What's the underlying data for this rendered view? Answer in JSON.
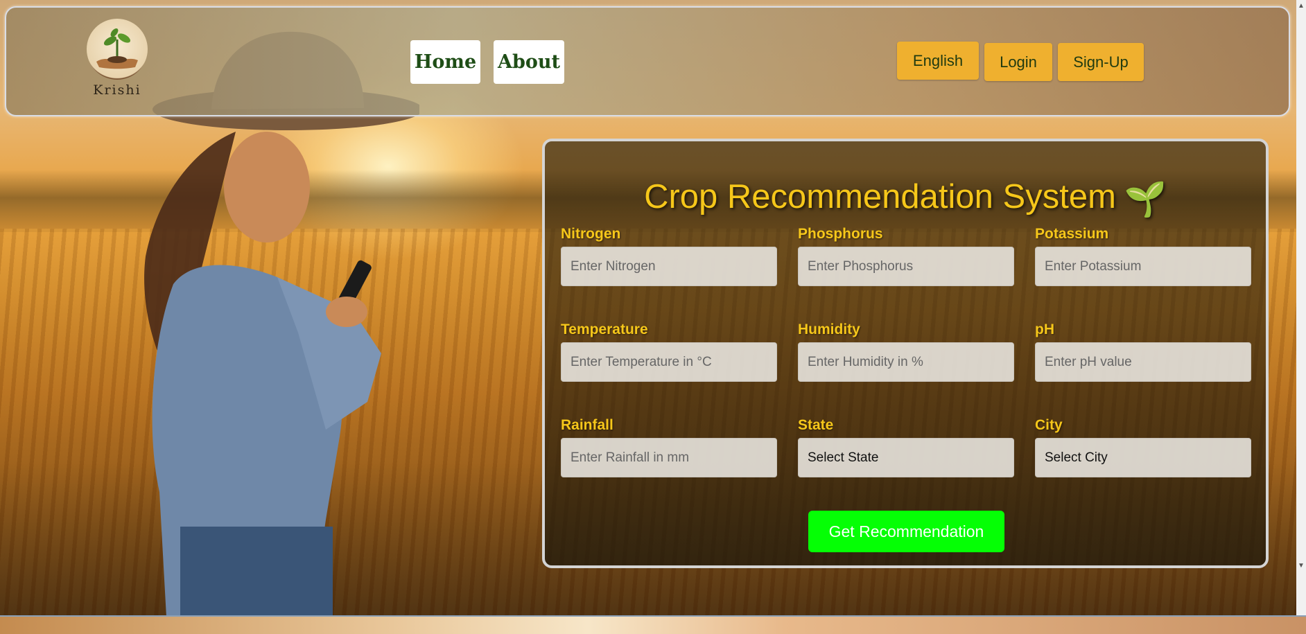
{
  "brand": {
    "name": "Krishi",
    "logo_icon": "hands-with-sprout-icon"
  },
  "nav": {
    "home": "Home",
    "about": "About"
  },
  "header_buttons": {
    "language": "English",
    "login": "Login",
    "signup": "Sign-Up"
  },
  "form": {
    "title": "Crop Recommendation System",
    "title_icon": "🌱",
    "fields": {
      "nitrogen": {
        "label": "Nitrogen",
        "placeholder": "Enter Nitrogen"
      },
      "phosphorus": {
        "label": "Phosphorus",
        "placeholder": "Enter Phosphorus"
      },
      "potassium": {
        "label": "Potassium",
        "placeholder": "Enter Potassium"
      },
      "temperature": {
        "label": "Temperature",
        "placeholder": "Enter Temperature in °C"
      },
      "humidity": {
        "label": "Humidity",
        "placeholder": "Enter Humidity in %"
      },
      "ph": {
        "label": "pH",
        "placeholder": "Enter pH value"
      },
      "rainfall": {
        "label": "Rainfall",
        "placeholder": "Enter Rainfall in mm"
      },
      "state": {
        "label": "State",
        "value": "Select State"
      },
      "city": {
        "label": "City",
        "value": "Select City"
      }
    },
    "submit_label": "Get Recommendation"
  },
  "colors": {
    "accent_yellow": "#f6c71a",
    "button_orange": "#efb02f",
    "submit_green": "#05ff05",
    "nav_text_green": "#1e4d16"
  }
}
